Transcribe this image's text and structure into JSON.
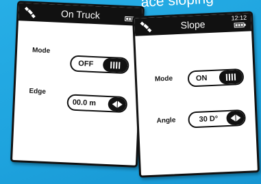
{
  "header_caption": "ace sloping",
  "screens": [
    {
      "title": "On Truck",
      "status": {
        "icons": [
          "satellite-icon",
          "battery-icon"
        ]
      },
      "mode": {
        "label": "Mode",
        "state": "OFF"
      },
      "edge": {
        "label": "Edge",
        "value": "00.0 m"
      }
    },
    {
      "title": "Slope",
      "status": {
        "time": "12:12",
        "icons": [
          "satellite-icon",
          "battery-icon"
        ]
      },
      "mode": {
        "label": "Mode",
        "state": "ON"
      },
      "angle": {
        "label": "Angle",
        "value": "30 D°"
      }
    }
  ],
  "colors": {
    "background": "#1ea3de",
    "screen": "#ffffff",
    "chrome": "#111111"
  }
}
